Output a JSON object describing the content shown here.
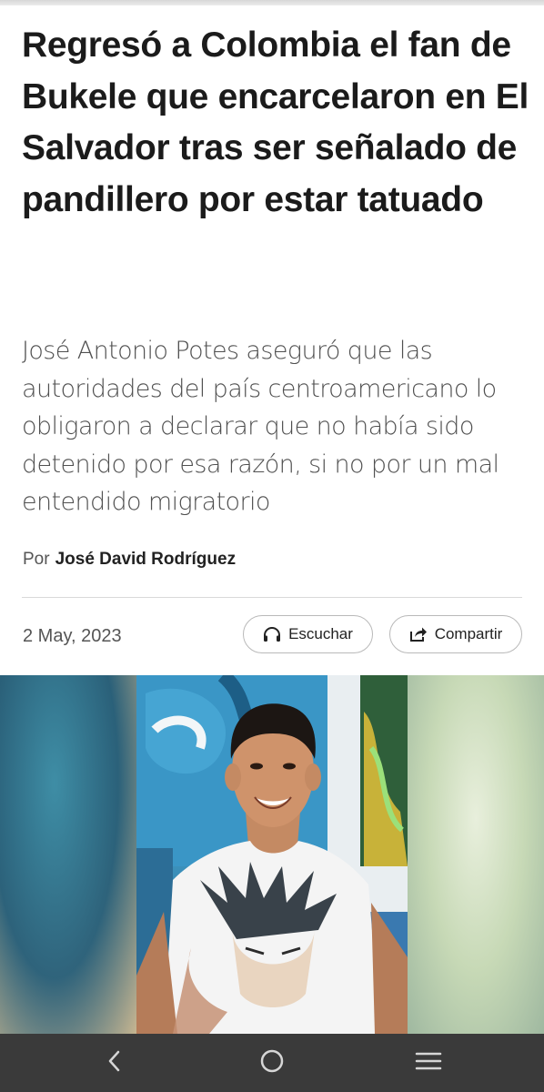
{
  "article": {
    "headline": "Regresó a Colombia el fan de Bukele que encarcelaron en El Salvador tras ser señalado de pandillero por estar tatuado",
    "subtitle": "José Antonio Potes aseguró que las autoridades del país centroamericano lo obligaron a declarar que no había sido detenido por esa razón, si no por un mal entendido migratorio",
    "byline_prefix": "Por",
    "author": "José David Rodríguez",
    "date": "2 May, 2023"
  },
  "actions": {
    "listen_label": "Escuchar",
    "listen_icon": "headphones-icon",
    "share_label": "Compartir",
    "share_icon": "share-icon"
  },
  "photo": {
    "subject": "young-man-goku-tshirt"
  },
  "navbar": {
    "back_icon": "back-chevron-icon",
    "home_icon": "home-circle-icon",
    "menu_icon": "recents-menu-icon"
  },
  "colors": {
    "navbar_bg": "#3a3a3a",
    "text_primary": "#1b1b1b",
    "text_secondary": "#505050"
  }
}
